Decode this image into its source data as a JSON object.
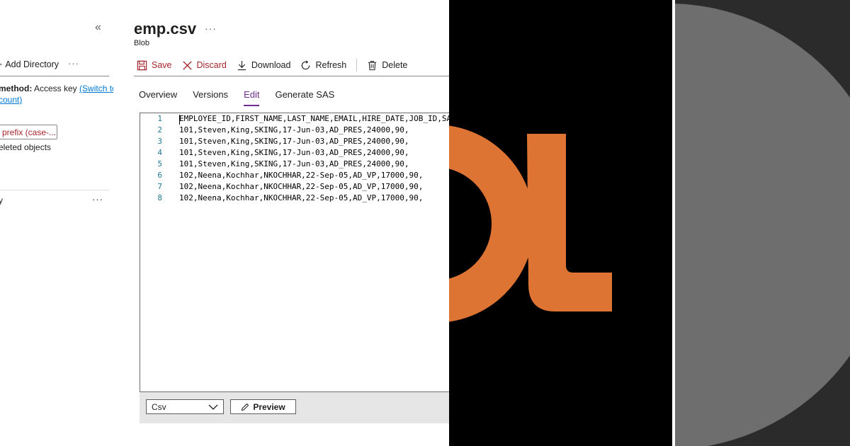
{
  "left_pane": {
    "collapse_glyph": "«",
    "add_directory_label": "Add Directory",
    "more_glyph": "···",
    "auth_method_label": "method:",
    "auth_method_value": "Access key",
    "auth_switch_link_part1": "(Switch to",
    "auth_switch_link_part2": "count)",
    "prefix_placeholder": "prefix (case-...",
    "deleted_objects_label": "eleted objects",
    "row_fragment": "y",
    "row_more_glyph": "···"
  },
  "header": {
    "title": "emp.csv",
    "more_glyph": "···",
    "subtitle": "Blob"
  },
  "toolbar": {
    "save_label": "Save",
    "discard_label": "Discard",
    "download_label": "Download",
    "refresh_label": "Refresh",
    "delete_label": "Delete"
  },
  "tabs": {
    "overview": "Overview",
    "versions": "Versions",
    "edit": "Edit",
    "generate_sas": "Generate SAS",
    "active": "Edit"
  },
  "editor": {
    "lines": [
      {
        "num": "1",
        "text": "EMPLOYEE_ID,FIRST_NAME,LAST_NAME,EMAIL,HIRE_DATE,JOB_ID,SALARY,DEPARTMENT_ID"
      },
      {
        "num": "2",
        "text": "101,Steven,King,SKING,17-Jun-03,AD_PRES,24000,90,"
      },
      {
        "num": "3",
        "text": "101,Steven,King,SKING,17-Jun-03,AD_PRES,24000,90,"
      },
      {
        "num": "4",
        "text": "101,Steven,King,SKING,17-Jun-03,AD_PRES,24000,90,"
      },
      {
        "num": "5",
        "text": "101,Steven,King,SKING,17-Jun-03,AD_PRES,24000,90,"
      },
      {
        "num": "6",
        "text": "102,Neena,Kochhar,NKOCHHAR,22-Sep-05,AD_VP,17000,90,"
      },
      {
        "num": "7",
        "text": "102,Neena,Kochhar,NKOCHHAR,22-Sep-05,AD_VP,17000,90,"
      },
      {
        "num": "8",
        "text": "102,Neena,Kochhar,NKOCHHAR,22-Sep-05,AD_VP,17000,90,"
      }
    ]
  },
  "footer": {
    "format_value": "Csv",
    "preview_label": "Preview"
  },
  "colors": {
    "accent_purple": "#6b2e8e",
    "danger_red": "#a4262c",
    "link_blue": "#0078d4",
    "logo_orange": "#dd7433",
    "logo_background": "#000000",
    "gray_panel": "#2b2b2b",
    "gray_disc": "#6e6e6e"
  }
}
